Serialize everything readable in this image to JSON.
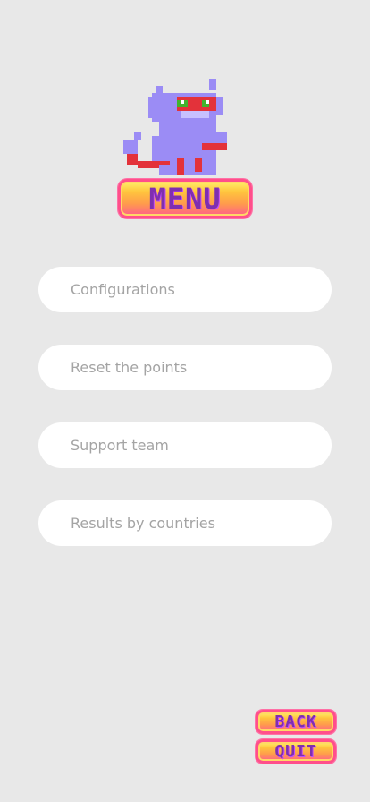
{
  "mascot": {
    "icon": "pixel-cat-icon"
  },
  "menu": {
    "badge": "MENU",
    "items": [
      {
        "label": "Configurations"
      },
      {
        "label": "Reset the points"
      },
      {
        "label": "Support team"
      },
      {
        "label": "Results by countries"
      }
    ]
  },
  "footer": {
    "back_label": "BACK",
    "quit_label": "QUIT"
  },
  "colors": {
    "background": "#e8e8e8",
    "card": "#ffffff",
    "badge_text": "#7f2fb0",
    "badge_border": "#ff4f8b"
  }
}
